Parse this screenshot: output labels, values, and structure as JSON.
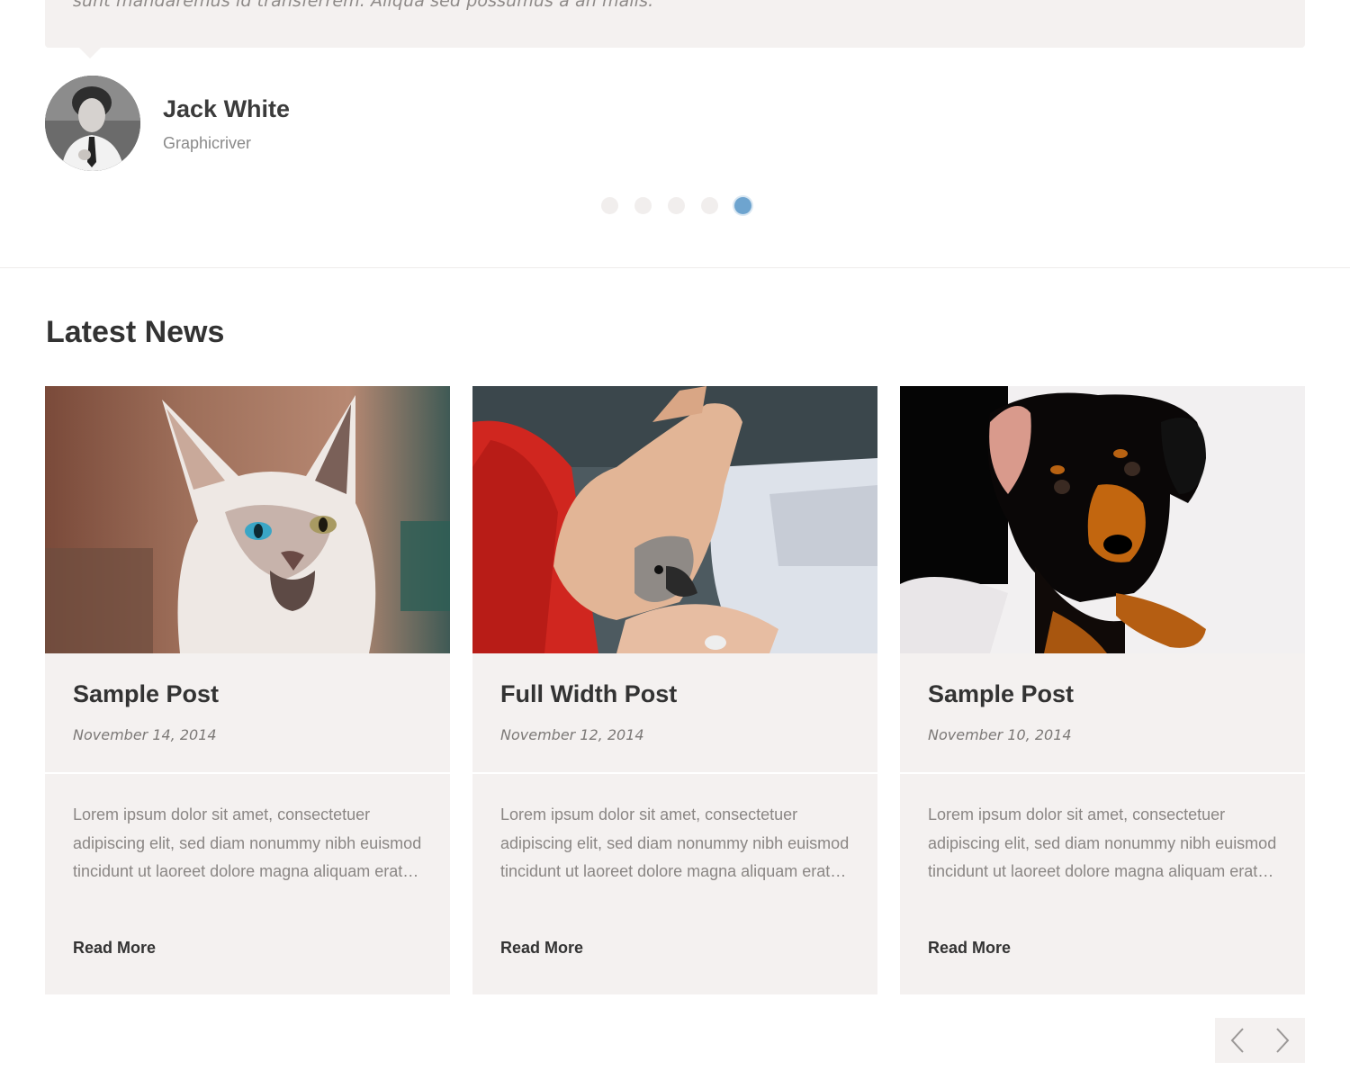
{
  "testimonial": {
    "quote": "sunt mandaremus id transferrem. Aliqua sed possumus a an malis.",
    "author_name": "Jack White",
    "author_company": "Graphicriver",
    "slider_active_index": 5,
    "slider_count": 5
  },
  "news": {
    "title": "Latest News",
    "posts": [
      {
        "title": "Sample Post",
        "date": "November 14, 2014",
        "excerpt": "Lorem ipsum dolor sit amet, consectetuer adipiscing elit, sed diam nonummy nibh euismod tincidunt ut laoreet dolore magna aliquam erat…",
        "read_more": "Read More",
        "image": "kitten-photo"
      },
      {
        "title": "Full Width Post",
        "date": "November 12, 2014",
        "excerpt": "Lorem ipsum dolor sit amet, consectetuer adipiscing elit, sed diam nonummy nibh euismod tincidunt ut laoreet dolore magna aliquam erat…",
        "read_more": "Read More",
        "image": "bird-nail-trim-photo"
      },
      {
        "title": "Sample Post",
        "date": "November 10, 2014",
        "excerpt": "Lorem ipsum dolor sit amet, consectetuer adipiscing elit, sed diam nonummy nibh euismod tincidunt ut laoreet dolore magna aliquam erat…",
        "read_more": "Read More",
        "image": "puppy-photo"
      }
    ]
  },
  "pager": {
    "prev_icon": "chevron-left-icon",
    "next_icon": "chevron-right-icon"
  },
  "colors": {
    "card_bg": "#f4f1f0",
    "accent_dot": "#6ea4cf",
    "heading": "#333333"
  }
}
